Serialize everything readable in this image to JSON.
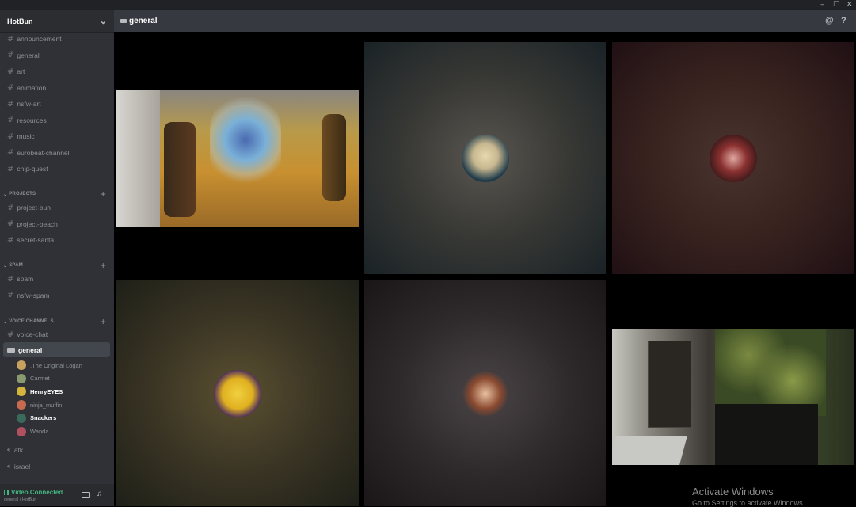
{
  "window": {
    "minimize": "–",
    "maximize": "☐",
    "close": "✕"
  },
  "server": {
    "name": "HotBun",
    "chevron": "⌄"
  },
  "text_channels": [
    {
      "name": "announcement",
      "icon": "#"
    },
    {
      "name": "general",
      "icon": "#"
    },
    {
      "name": "art",
      "icon": "#"
    },
    {
      "name": "animation",
      "icon": "#"
    },
    {
      "name": "nsfw-art",
      "icon": "#"
    },
    {
      "name": "resources",
      "icon": "#"
    },
    {
      "name": "music",
      "icon": "#"
    },
    {
      "name": "eurobeat-channel",
      "icon": "#"
    },
    {
      "name": "chip-quest",
      "icon": "#"
    }
  ],
  "categories": {
    "projects": {
      "label": "PROJECTS",
      "plus": "+"
    },
    "spam": {
      "label": "SPAM",
      "plus": "+"
    },
    "voice": {
      "label": "VOICE CHANNELS",
      "plus": "+"
    }
  },
  "project_channels": [
    {
      "name": "project-bun",
      "icon": "#"
    },
    {
      "name": "project-beach",
      "icon": "#"
    },
    {
      "name": "secret-santa",
      "icon": "#"
    }
  ],
  "spam_channels": [
    {
      "name": "spam",
      "icon": "#"
    },
    {
      "name": "nsfw-spam",
      "icon": "#"
    }
  ],
  "voice_channels": {
    "first": "voice-chat",
    "active": "general",
    "afk": "afk",
    "israel": "israel"
  },
  "voice_users": [
    {
      "name": ".The Original Logan",
      "color": "#c8a060"
    },
    {
      "name": "Carmet",
      "color": "#8a9a70"
    },
    {
      "name": "HenryEYES",
      "color": "#d4b43c"
    },
    {
      "name": "ninja_muffin",
      "color": "#c86a50"
    },
    {
      "name": "Snackers",
      "color": "#3a6a5a"
    },
    {
      "name": "Wanda",
      "color": "#b05060"
    }
  ],
  "status": {
    "connected": "Video Connected",
    "sub": "general / HotBun"
  },
  "header": {
    "channel": "general",
    "mention_icon": "@",
    "help_icon": "?"
  },
  "watermark": {
    "line1": "Activate Windows",
    "line2": "Go to Settings to activate Windows."
  },
  "colors": {
    "sidebar": "#2f3136",
    "header": "#36393f",
    "connected": "#43b581",
    "accent": "#7289da"
  }
}
